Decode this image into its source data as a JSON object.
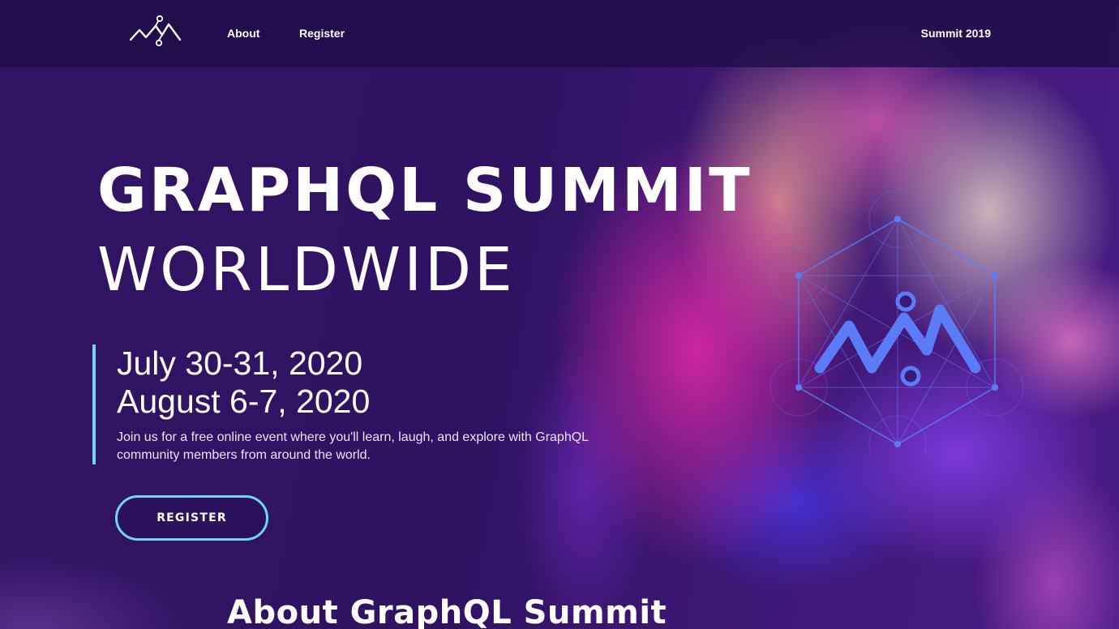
{
  "nav": {
    "logo_icon": "summit-logo-icon",
    "about_label": "About",
    "register_label": "Register",
    "summit_2019_label": "Summit 2019"
  },
  "hero": {
    "title": "GRAPHQL SUMMIT",
    "subtitle": "WORLDWIDE",
    "date_1": "July 30-31, 2020",
    "date_2": "August 6-7, 2020",
    "description": "Join us for a free online event where you'll learn, laugh, and explore with GraphQL community members from around the world.",
    "register_button_label": "REGISTER",
    "graphic_icon": "summit-hexagon-graphic-icon"
  },
  "about": {
    "heading": "About GraphQL Summit"
  },
  "colors": {
    "accent": "#6fd6f2",
    "graphic_blue": "#5b7cf6",
    "nav_background": "#1e0e48",
    "background": "#2a1259"
  }
}
